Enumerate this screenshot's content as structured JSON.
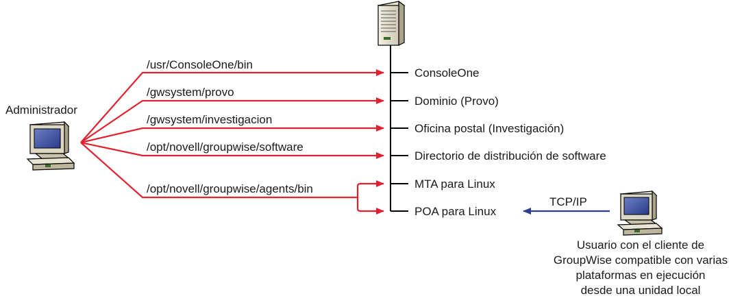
{
  "diagram": {
    "admin_label": "Administrador",
    "user_caption": [
      "Usuario con el cliente de",
      "GroupWise compatible con varias",
      "plataformas en ejecución",
      "desde una unidad local"
    ],
    "protocol_label": "TCP/IP",
    "server_items": [
      "ConsoleOne",
      "Dominio (Provo)",
      "Oficina postal (Investigación)",
      "Directorio de distribución de software",
      "MTA para Linux",
      "POA para Linux"
    ],
    "paths": [
      "/usr/ConsoleOne/bin",
      "/gwsystem/provo",
      "/gwsystem/investigacion",
      "/opt/novell/groupwise/software",
      "/opt/novell/groupwise/agents/bin"
    ],
    "colors": {
      "admin_links": "#e0212f",
      "client_link": "#2a3d8f"
    },
    "icons": {
      "server": "server-tower-icon",
      "admin_workstation": "workstation-icon",
      "user_workstation": "workstation-icon"
    }
  }
}
